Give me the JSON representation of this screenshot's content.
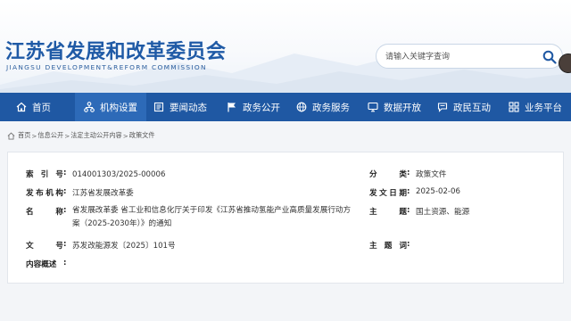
{
  "header": {
    "title": "江苏省发展和改革委员会",
    "subtitle": "JIANGSU DEVELOPMENT&REFORM COMMISSION"
  },
  "search": {
    "placeholder": "请输入关键字查询"
  },
  "nav": {
    "items": [
      {
        "label": "首页",
        "icon": "home-icon"
      },
      {
        "label": "机构设置",
        "icon": "org-chart-icon"
      },
      {
        "label": "要闻动态",
        "icon": "newspaper-icon"
      },
      {
        "label": "政务公开",
        "icon": "flag-icon"
      },
      {
        "label": "政务服务",
        "icon": "globe-icon"
      },
      {
        "label": "数据开放",
        "icon": "monitor-icon"
      },
      {
        "label": "政民互动",
        "icon": "chat-icon"
      },
      {
        "label": "业务平台",
        "icon": "grid-icon"
      }
    ],
    "active_index": 1
  },
  "breadcrumb": {
    "items": [
      "首页",
      "信息公开",
      "法定主动公开内容",
      "政策文件"
    ],
    "separator": ">"
  },
  "document_info": {
    "index_no": {
      "label": "索引号",
      "value": "014001303/2025-00006"
    },
    "issuer": {
      "label": "发布机构",
      "value": "江苏省发展改革委"
    },
    "title": {
      "label": "名称",
      "value": "省发展改革委 省工业和信息化厅关于印发《江苏省推动氢能产业高质量发展行动方案（2025-2030年）》的通知"
    },
    "doc_no": {
      "label": "文号",
      "value": "苏发改能源发〔2025〕101号"
    },
    "summary": {
      "label": "内容概述",
      "value": ""
    },
    "category": {
      "label": "分类",
      "value": "政策文件"
    },
    "issue_date": {
      "label": "发文日期",
      "value": "2025-02-06"
    },
    "topic": {
      "label": "主题",
      "value": "国土资源、能源"
    },
    "keywords": {
      "label": "主题词",
      "value": ""
    }
  },
  "colors": {
    "brand_blue": "#1f58a3",
    "nav_active": "#2d6ab8",
    "title_blue": "#1f5aa6"
  }
}
